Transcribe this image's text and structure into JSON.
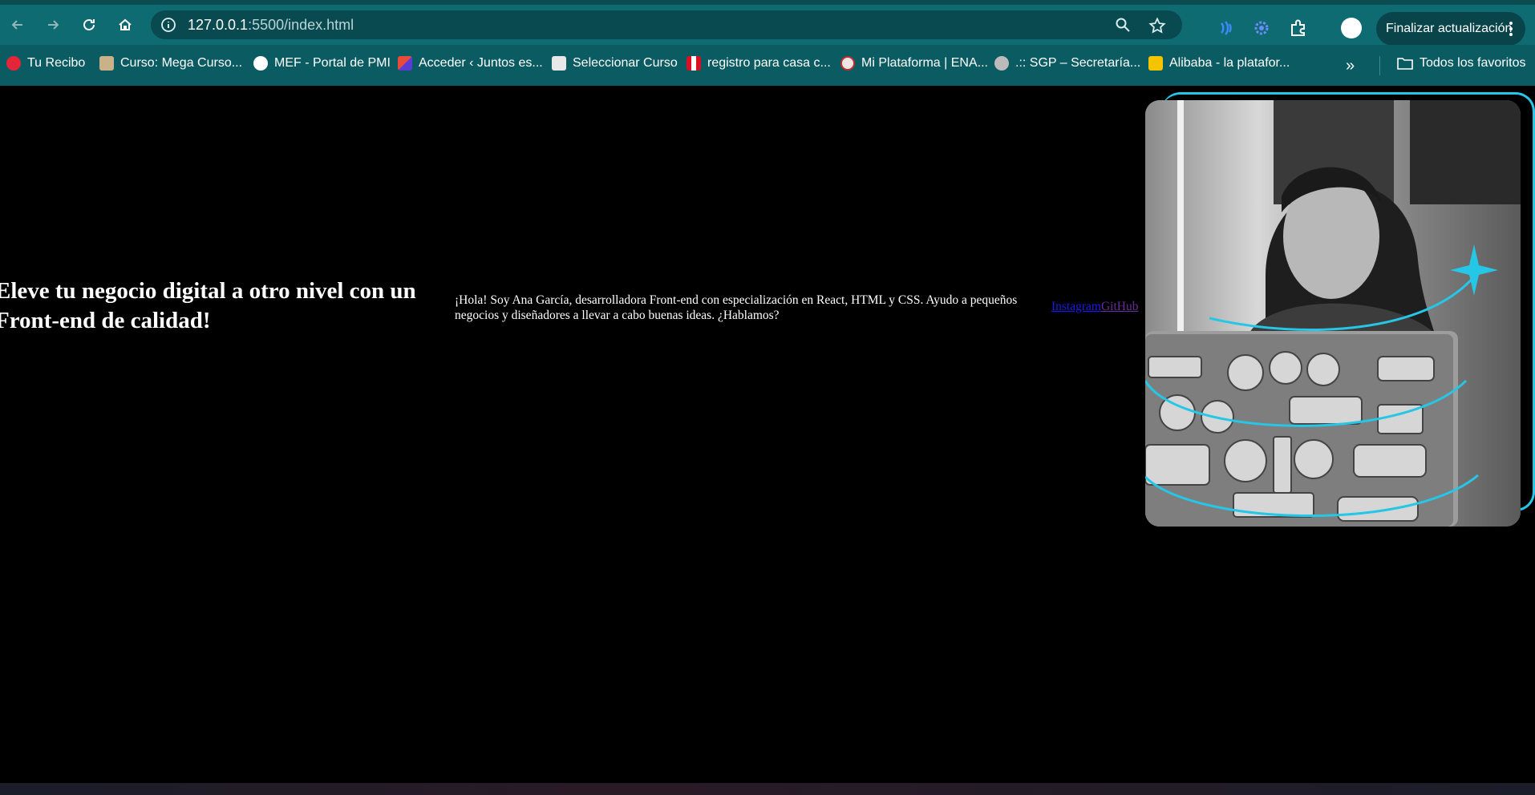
{
  "browser": {
    "url_host": "127.0.0.1",
    "url_rest": ":5500/index.html",
    "update_label": "Finalizar actualización"
  },
  "bookmarks": {
    "items": [
      {
        "label": "Tu Recibo",
        "icon": "lips-icon",
        "color": "#e3263a"
      },
      {
        "label": "Curso: Mega Curso...",
        "icon": "course-icon",
        "color": "#c9b28a"
      },
      {
        "label": "MEF - Portal de PMI",
        "icon": "globe-icon",
        "color": "#ffffff"
      },
      {
        "label": "Acceder ‹ Juntos es...",
        "icon": "squares-icon",
        "color": "#e84b3a"
      },
      {
        "label": "Seleccionar Curso",
        "icon": "page-icon",
        "color": "#e8e8e8"
      },
      {
        "label": "registro para casa c...",
        "icon": "peru-flag-icon",
        "color": "#d91023"
      },
      {
        "label": "Mi Plataforma | ENA...",
        "icon": "emblem-icon",
        "color": "#c03030"
      },
      {
        "label": ".:: SGP – Secretaría...",
        "icon": "wordpress-icon",
        "color": "#bbbbbb"
      },
      {
        "label": "Alibaba - la platafor...",
        "icon": "alibaba-icon",
        "color": "#f5c400"
      }
    ],
    "all_favorites": "Todos los favoritos"
  },
  "page": {
    "title": "Eleve tu negocio digital a otro nivel con un Front-end de calidad!",
    "description": "¡Hola! Soy Ana García, desarrolladora Front-end con especialización en React, HTML y CSS. Ayudo a pequeños negocios y diseñadores a llevar a cabo buenas ideas. ¿Hablamos?",
    "links": [
      {
        "label": "Instagram"
      },
      {
        "label": "GitHub"
      }
    ],
    "accent_color": "#26c6e6"
  }
}
